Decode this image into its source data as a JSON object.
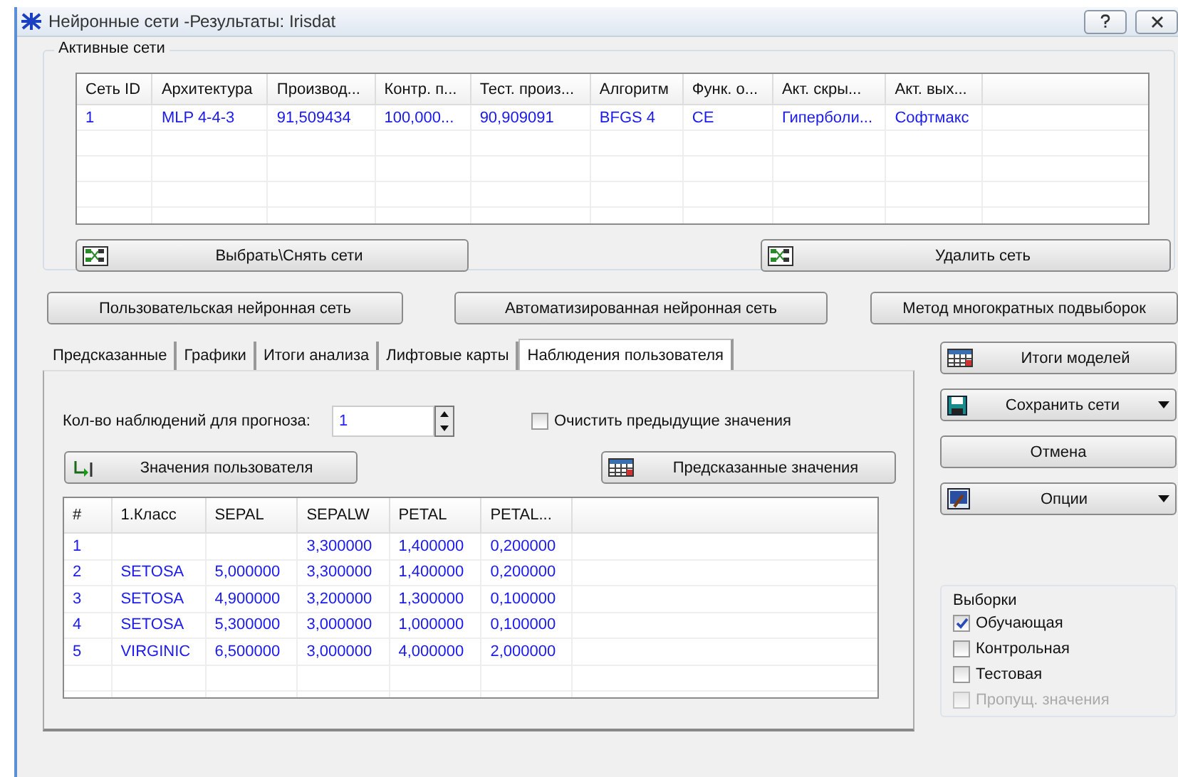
{
  "window": {
    "title": "Нейронные сети -Результаты: Irisdat"
  },
  "active_networks": {
    "label": "Активные сети",
    "columns": [
      "Сеть ID",
      "Архитектура",
      "Производ...",
      "Контр. п...",
      "Тест. произ...",
      "Алгоритм",
      "Функ. о...",
      "Акт. скры...",
      "Акт. вых..."
    ],
    "rows": [
      [
        "1",
        "MLP 4-4-3",
        "91,509434",
        "100,000...",
        "90,909091",
        "BFGS 4",
        "CE",
        "Гиперболи...",
        "Софтмакс"
      ]
    ],
    "buttons": [
      {
        "label": "Выбрать\\Снять сети",
        "kind": "network"
      },
      {
        "label": "Удалить сеть",
        "kind": "network"
      }
    ]
  },
  "mode_buttons": [
    "Пользовательская нейронная сеть",
    "Автоматизированная нейронная сеть",
    "Метод многократных подвыборок"
  ],
  "tabs": [
    {
      "label": "Предсказанные",
      "selected": false
    },
    {
      "label": "Графики",
      "selected": false
    },
    {
      "label": "Итоги анализа",
      "selected": false
    },
    {
      "label": "Лифтовые карты",
      "selected": false
    },
    {
      "label": "Наблюдения пользователя",
      "selected": true
    }
  ],
  "forecast": {
    "label": "Кол-во наблюдений для прогноза:",
    "value": "1"
  },
  "clear_previous": {
    "label": "Очистить предыдущие значения",
    "checked": false
  },
  "panel_buttons": [
    {
      "label": "Значения пользователя",
      "kind": "arrow"
    },
    {
      "label": "Предсказанные значения",
      "kind": "table"
    }
  ],
  "observations": {
    "columns": [
      "#",
      "1.Класс",
      "SEPAL",
      "SEPALW",
      "PETAL",
      "PETAL..."
    ],
    "rows": [
      [
        "1",
        "",
        "",
        "3,300000",
        "1,400000",
        "0,200000"
      ],
      [
        "2",
        "SETOSA",
        "5,000000",
        "3,300000",
        "1,400000",
        "0,200000"
      ],
      [
        "3",
        "SETOSA",
        "4,900000",
        "3,200000",
        "1,300000",
        "0,100000"
      ],
      [
        "4",
        "SETOSA",
        "5,300000",
        "3,000000",
        "1,000000",
        "0,100000"
      ],
      [
        "5",
        "VIRGINIC",
        "6,500000",
        "3,000000",
        "4,000000",
        "2,000000"
      ]
    ]
  },
  "side_buttons": [
    {
      "label": "Итоги моделей",
      "kind": "table",
      "dropdown": false
    },
    {
      "label": "Сохранить сети",
      "kind": "disk",
      "dropdown": true
    },
    {
      "label": "Отмена",
      "kind": "plain",
      "dropdown": false
    },
    {
      "label": "Опции",
      "kind": "picture",
      "dropdown": true
    }
  ],
  "samples": {
    "label": "Выборки",
    "items": [
      {
        "label": "Обучающая",
        "checked": true,
        "disabled": false
      },
      {
        "label": "Контрольная",
        "checked": false,
        "disabled": false
      },
      {
        "label": "Тестовая",
        "checked": false,
        "disabled": false
      },
      {
        "label": "Пропущ. значения",
        "checked": false,
        "disabled": true
      }
    ]
  }
}
